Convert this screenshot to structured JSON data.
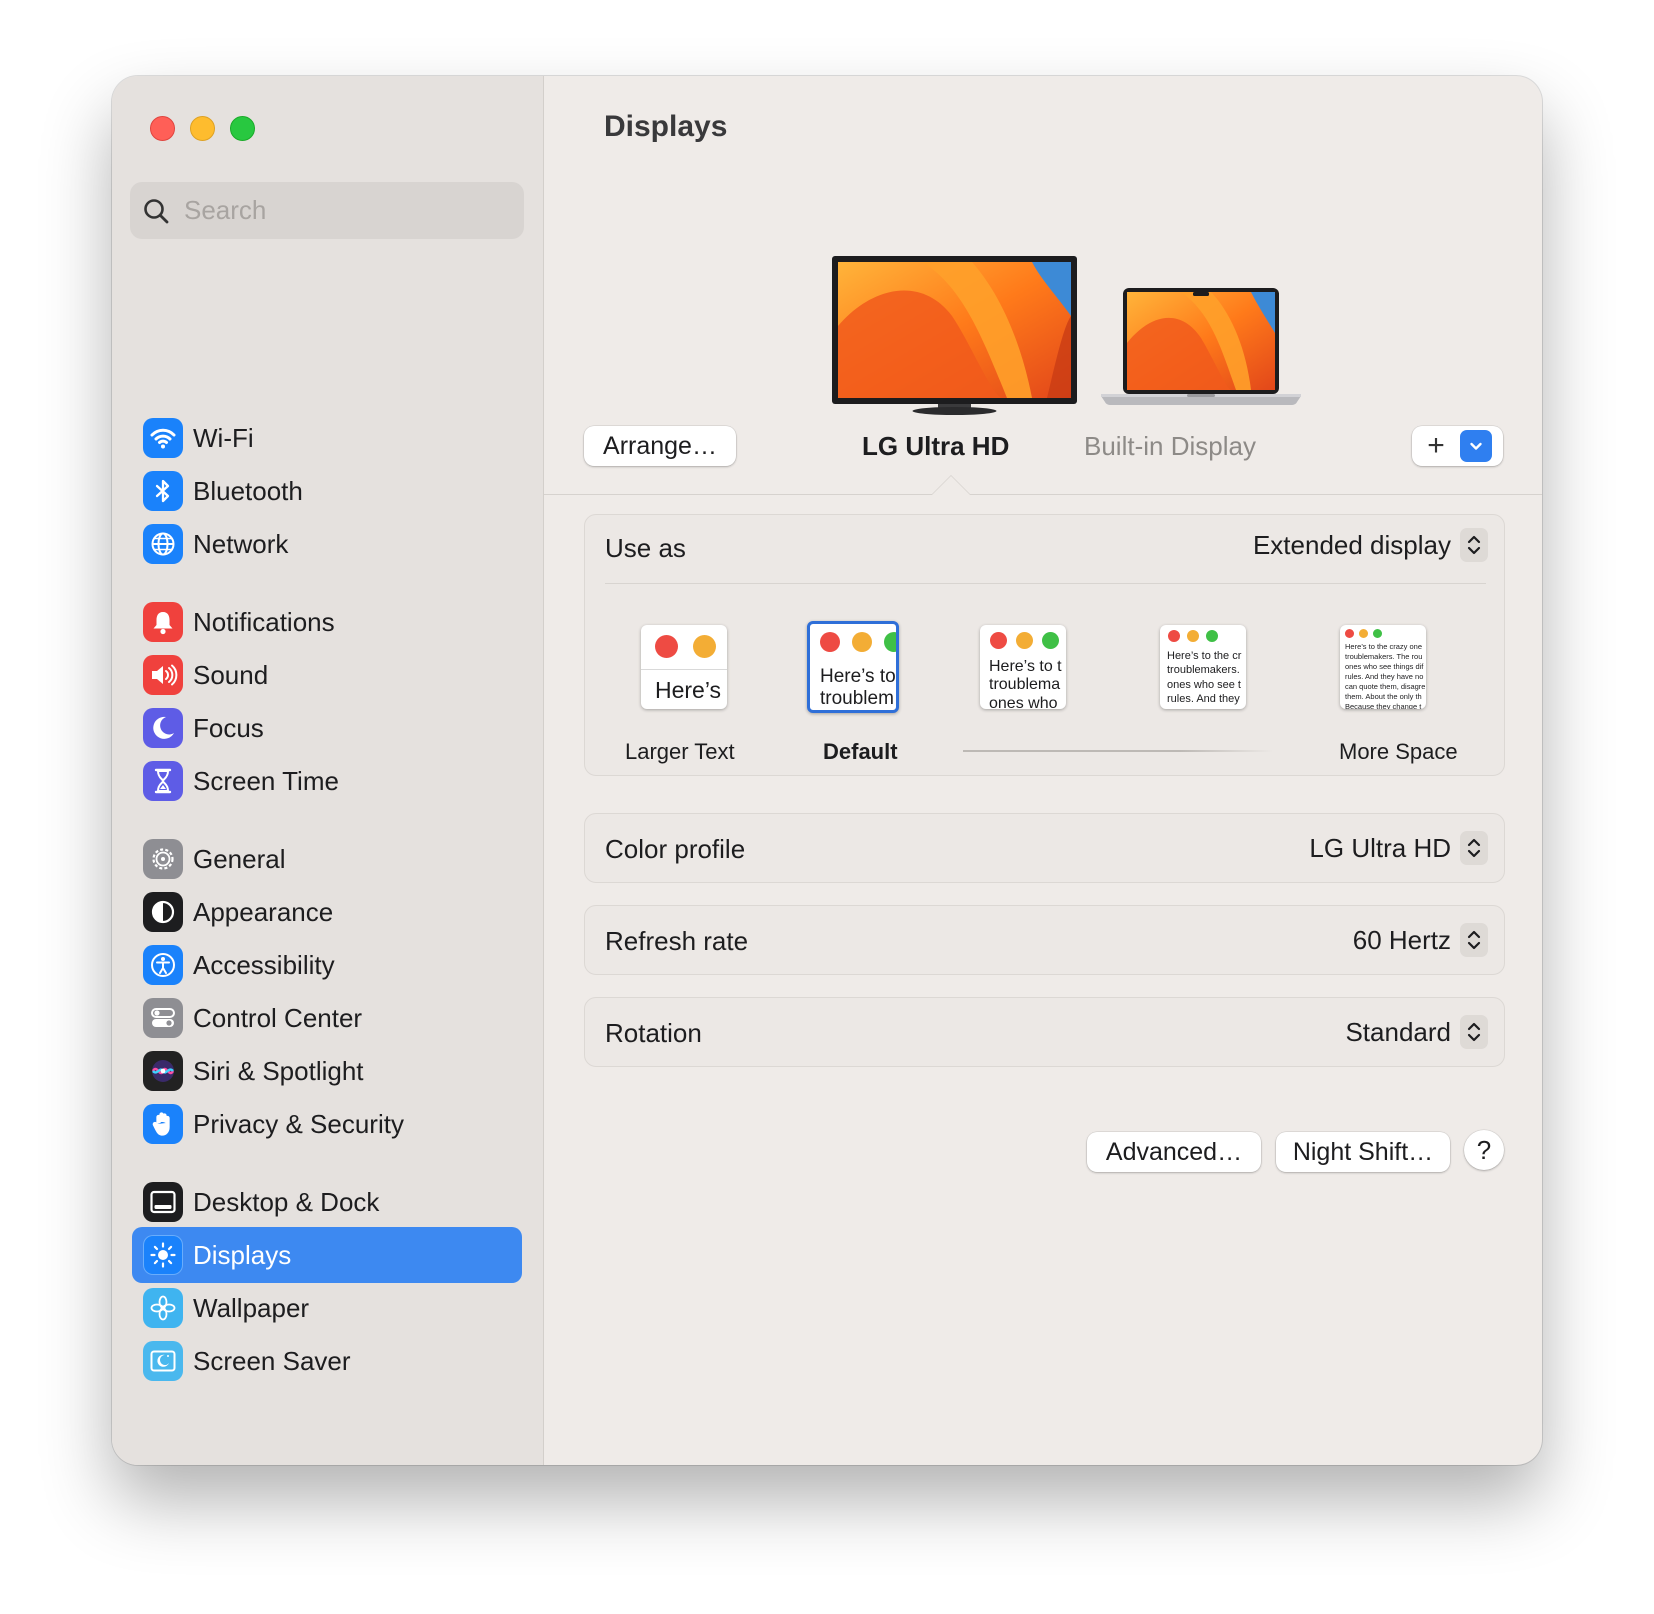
{
  "window": {
    "title": "Displays"
  },
  "search": {
    "placeholder": "Search"
  },
  "sidebar": {
    "items": [
      {
        "label": "Wi-Fi",
        "icon": "wifi-icon",
        "color": "#1a82fb"
      },
      {
        "label": "Bluetooth",
        "icon": "bluetooth-icon",
        "color": "#1a82fb"
      },
      {
        "label": "Network",
        "icon": "globe-icon",
        "color": "#1a82fb"
      },
      {
        "label": "Notifications",
        "icon": "bell-icon",
        "color": "#f0413d"
      },
      {
        "label": "Sound",
        "icon": "speaker-icon",
        "color": "#f0413d"
      },
      {
        "label": "Focus",
        "icon": "moon-icon",
        "color": "#5e5ce6"
      },
      {
        "label": "Screen Time",
        "icon": "hourglass-icon",
        "color": "#5e5ce6"
      },
      {
        "label": "General",
        "icon": "gear-icon",
        "color": "#8e8e93"
      },
      {
        "label": "Appearance",
        "icon": "appearance-icon",
        "color": "#1d1d1f"
      },
      {
        "label": "Accessibility",
        "icon": "accessibility-icon",
        "color": "#1a82fb"
      },
      {
        "label": "Control Center",
        "icon": "toggles-icon",
        "color": "#8e8e93"
      },
      {
        "label": "Siri & Spotlight",
        "icon": "siri-icon",
        "color": "#222222"
      },
      {
        "label": "Privacy & Security",
        "icon": "hand-icon",
        "color": "#1a82fb"
      },
      {
        "label": "Desktop & Dock",
        "icon": "dock-icon",
        "color": "#1d1d1f"
      },
      {
        "label": "Displays",
        "icon": "sun-icon",
        "color": "#1a82fb",
        "selected": true
      },
      {
        "label": "Wallpaper",
        "icon": "flower-icon",
        "color": "#3fb4f0"
      },
      {
        "label": "Screen Saver",
        "icon": "screensaver-icon",
        "color": "#4ab8ee"
      }
    ]
  },
  "displays": {
    "arrange_label": "Arrange…",
    "items": [
      {
        "name": "LG Ultra HD",
        "selected": true
      },
      {
        "name": "Built-in Display",
        "selected": false
      }
    ],
    "add_label": "+"
  },
  "use_as": {
    "label": "Use as",
    "value": "Extended display",
    "scales": [
      {
        "preview": "Here’s",
        "label": "Larger Text"
      },
      {
        "preview": "Here’s to\ntroublem",
        "label": "Default",
        "selected": true
      },
      {
        "preview": "Here’s to t\ntroublema\nones who",
        "label": ""
      },
      {
        "preview": "Here’s to the cr\ntroublemakers.\nones who see t\nrules. And they",
        "label": ""
      },
      {
        "preview": "Here’s to the crazy one\ntroublemakers. The rou\nones who see things dif\nrules. And they have no\ncan quote them, disagre\nthem. About the only th\nBecause they change t",
        "label": "More Space"
      }
    ]
  },
  "settings": [
    {
      "label": "Color profile",
      "value": "LG Ultra HD"
    },
    {
      "label": "Refresh rate",
      "value": "60 Hertz"
    },
    {
      "label": "Rotation",
      "value": "Standard"
    }
  ],
  "footer": {
    "advanced_label": "Advanced…",
    "night_shift_label": "Night Shift…",
    "help_label": "?"
  },
  "colors": {
    "accent": "#3d89f1",
    "traffic_red": "#ff5f57",
    "traffic_yellow": "#febc2e",
    "traffic_green": "#28c840"
  }
}
